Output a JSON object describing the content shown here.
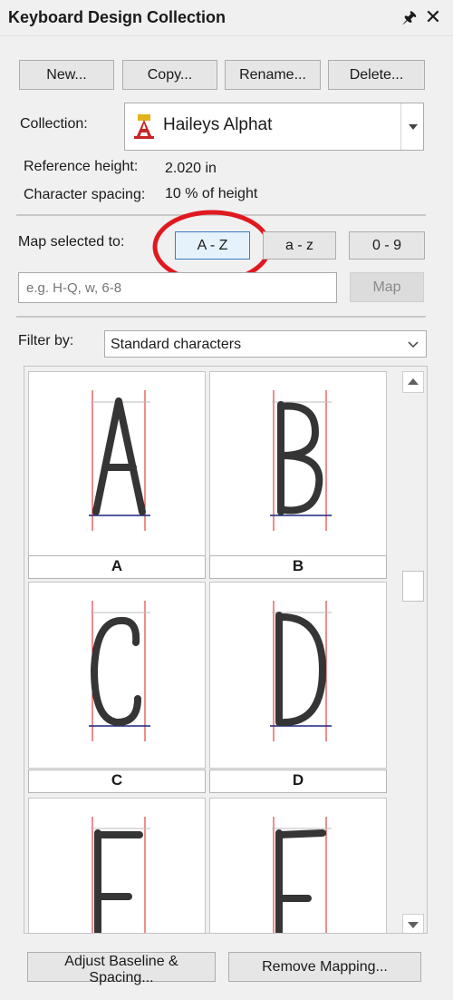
{
  "title": "Keyboard Design Collection",
  "buttons": {
    "new": "New...",
    "copy": "Copy...",
    "rename": "Rename...",
    "delete": "Delete..."
  },
  "collection": {
    "label": "Collection:",
    "value": "Haileys Alphat"
  },
  "reference_height": {
    "label": "Reference height:",
    "value": "2.020 in"
  },
  "character_spacing": {
    "label": "Character spacing:",
    "value": "10 % of height"
  },
  "map": {
    "label": "Map selected to:",
    "upper": "A - Z",
    "lower": "a - z",
    "digits": "0 - 9",
    "input_placeholder": "e.g. H-Q, w, 6-8",
    "map_button": "Map"
  },
  "filter": {
    "label": "Filter by:",
    "value": "Standard characters"
  },
  "glyphs": [
    "A",
    "B",
    "C",
    "D",
    "E",
    "F"
  ],
  "footer": {
    "adjust": "Adjust Baseline & Spacing...",
    "remove": "Remove Mapping..."
  },
  "colors": {
    "guide": "#e21b1b",
    "baseline": "#1a237e",
    "stitch": "#353535",
    "highlight_circle": "#e0191f",
    "accent": "#3c7fc0"
  }
}
